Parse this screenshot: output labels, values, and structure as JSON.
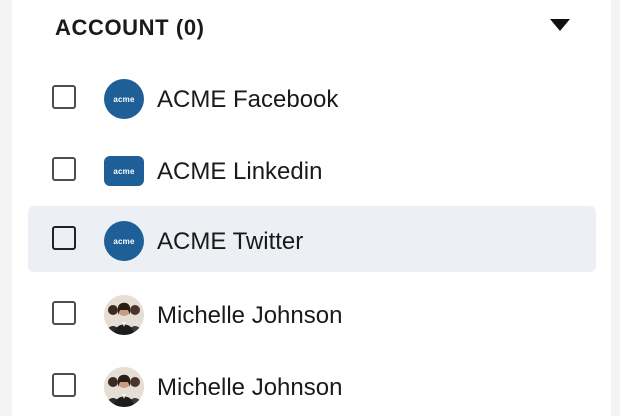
{
  "section": {
    "title": "ACCOUNT (0)",
    "caret_icon": "caret-down-icon"
  },
  "accounts": [
    {
      "label": "ACME Facebook",
      "avatar_text": "acme",
      "avatar_type": "logo",
      "checked": false,
      "highlighted": false
    },
    {
      "label": "ACME Linkedin",
      "avatar_text": "acme",
      "avatar_type": "logo",
      "checked": false,
      "highlighted": false
    },
    {
      "label": "ACME Twitter",
      "avatar_text": "acme",
      "avatar_type": "logo",
      "checked": false,
      "highlighted": true
    },
    {
      "label": "Michelle Johnson",
      "avatar_type": "photo",
      "checked": false,
      "highlighted": false
    },
    {
      "label": "Michelle Johnson",
      "avatar_type": "photo",
      "checked": false,
      "highlighted": false
    }
  ],
  "colors": {
    "brand_blue": "#1f5f97",
    "highlight_bg": "#eceff3",
    "text": "#1a1a1a"
  }
}
